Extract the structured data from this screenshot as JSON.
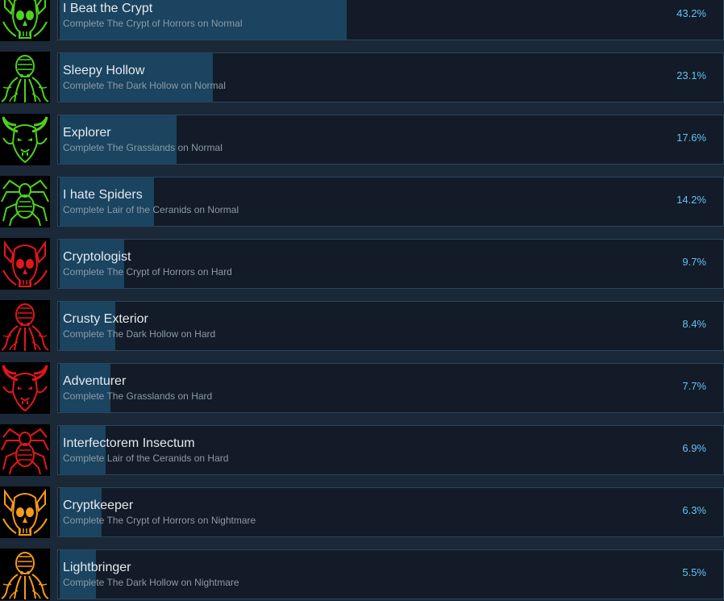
{
  "achievements": [
    {
      "title": "I Beat the Crypt",
      "desc": "Complete The Crypt of Horrors on Normal",
      "percent": "43.2%",
      "fraction": 0.432,
      "icon": "skull-icon",
      "color": "#4fd11c"
    },
    {
      "title": "Sleepy Hollow",
      "desc": "Complete The Dark Hollow on Normal",
      "percent": "23.1%",
      "fraction": 0.231,
      "icon": "octopus-icon",
      "color": "#4fd11c"
    },
    {
      "title": "Explorer",
      "desc": "Complete The Grasslands on Normal",
      "percent": "17.6%",
      "fraction": 0.176,
      "icon": "horned-beast-icon",
      "color": "#4fd11c"
    },
    {
      "title": "I hate Spiders",
      "desc": "Complete Lair of the Ceranids on Normal",
      "percent": "14.2%",
      "fraction": 0.142,
      "icon": "spider-icon",
      "color": "#4fd11c"
    },
    {
      "title": "Cryptologist",
      "desc": "Complete The Crypt of Horrors on Hard",
      "percent": "9.7%",
      "fraction": 0.097,
      "icon": "skull-icon",
      "color": "#e3161b"
    },
    {
      "title": "Crusty Exterior",
      "desc": "Complete The Dark Hollow on Hard",
      "percent": "8.4%",
      "fraction": 0.084,
      "icon": "octopus-icon",
      "color": "#e3161b"
    },
    {
      "title": "Adventurer",
      "desc": "Complete The Grasslands on Hard",
      "percent": "7.7%",
      "fraction": 0.077,
      "icon": "horned-beast-icon",
      "color": "#e3161b"
    },
    {
      "title": "Interfectorem Insectum",
      "desc": "Complete Lair of the Ceranids on Hard",
      "percent": "6.9%",
      "fraction": 0.069,
      "icon": "spider-icon",
      "color": "#e3161b"
    },
    {
      "title": "Cryptkeeper",
      "desc": "Complete The Crypt of Horrors on Nightmare",
      "percent": "6.3%",
      "fraction": 0.063,
      "icon": "skull-icon",
      "color": "#f59a1a"
    },
    {
      "title": "Lightbringer",
      "desc": "Complete The Dark Hollow on Nightmare",
      "percent": "5.5%",
      "fraction": 0.055,
      "icon": "octopus-icon",
      "color": "#f59a1a"
    }
  ]
}
